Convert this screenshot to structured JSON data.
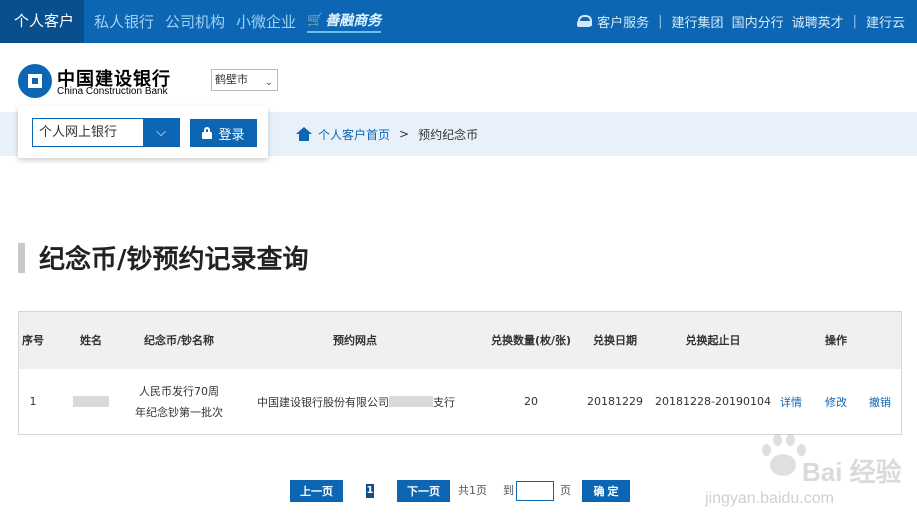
{
  "topnav": {
    "items": [
      {
        "label": "个人客户"
      },
      {
        "label": "私人银行"
      },
      {
        "label": "公司机构"
      },
      {
        "label": "小微企业"
      }
    ],
    "shan_label": "善融商务",
    "customer_service": "客户服务",
    "links": [
      "建行集团",
      "国内分行",
      "诚聘英才",
      "建行云"
    ]
  },
  "brand": {
    "name_cn": "中国建设银行",
    "name_en": "China Construction Bank",
    "city": "鹤壁市"
  },
  "login": {
    "bank_select_value": "个人网上银行",
    "login_label": "登录"
  },
  "breadcrumb": {
    "home": "个人客户首页",
    "separator": ">",
    "current": "预约纪念币"
  },
  "page": {
    "title": "纪念币/钞预约记录查询"
  },
  "table": {
    "headers": [
      "序号",
      "姓名",
      "纪念币/钞名称",
      "预约网点",
      "兑换数量(枚/张)",
      "兑换日期",
      "兑换起止日",
      "操作"
    ],
    "rows": [
      {
        "index": "1",
        "coin_name": "人民币发行70周年纪念钞第一批次",
        "branch_prefix": "中国建设银行股份有限公司",
        "branch_suffix": "支行",
        "quantity": "20",
        "date": "20181229",
        "period": "20181228-20190104",
        "actions": [
          "详情",
          "修改",
          "撤销"
        ]
      }
    ]
  },
  "pager": {
    "prev": "上一页",
    "current": "1",
    "next": "下一页",
    "total": "共1页",
    "goto": "到",
    "page_unit": "页",
    "confirm": "确 定"
  },
  "watermark": {
    "logo_text": "Bai  经验",
    "url": "jingyan.baidu.com"
  },
  "colors": {
    "primary": "#0d66b3",
    "primary_dark": "#0a4f8d",
    "band": "#e8f1fa",
    "table_header": "#f0f0f0"
  }
}
